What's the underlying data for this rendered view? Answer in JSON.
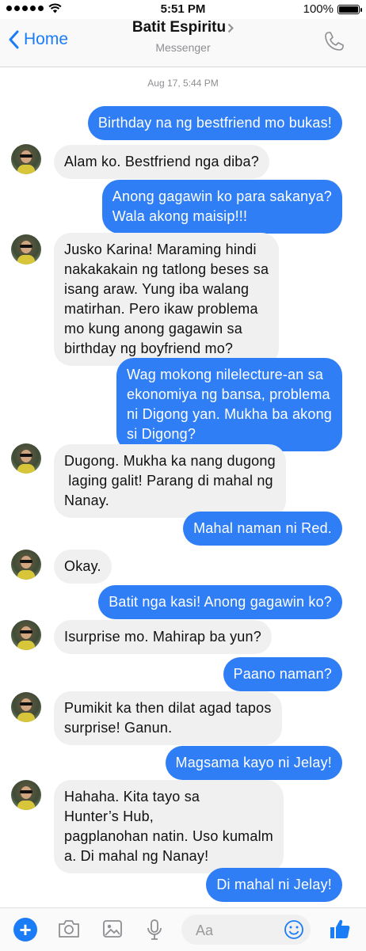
{
  "status_bar": {
    "time": "5:51 PM",
    "battery": "100%"
  },
  "header": {
    "back_label": "Home",
    "contact_name": "Batit Espiritu",
    "subtitle": "Messenger",
    "icons": {
      "back": "chevron-left-icon",
      "call": "phone-icon"
    }
  },
  "conversation": {
    "timestamp": "Aug 17, 5:44 PM",
    "messages": [
      {
        "side": "out",
        "lines": [
          "Birthday na ng bestfriend mo bukas!"
        ]
      },
      {
        "side": "in",
        "lines": [
          "Alam ko. Bestfriend nga diba?"
        ]
      },
      {
        "side": "out",
        "lines": [
          "Anong gagawin ko para sakanya?",
          "Wala akong maisip!!!"
        ]
      },
      {
        "side": "in",
        "lines": [
          "Jusko Karina! Maraming hindi",
          "nakakakain ng tatlong beses sa",
          "isang araw. Yung iba walang",
          "matirhan. Pero ikaw problema",
          "mo kung anong gagawin sa",
          "birthday ng boyfriend mo?"
        ]
      },
      {
        "side": "out",
        "lines": [
          "Wag mokong nilelecture-an sa",
          "ekonomiya ng bansa, problema",
          "ni Digong yan. Mukha ba akong",
          "si Digong?"
        ]
      },
      {
        "side": "in",
        "lines": [
          "Dugong. Mukha ka nang dugong",
          " laging galit! Parang di mahal ng",
          "Nanay."
        ]
      },
      {
        "side": "out",
        "lines": [
          "Mahal naman ni Red."
        ]
      },
      {
        "side": "in",
        "lines": [
          "Okay."
        ]
      },
      {
        "side": "out",
        "lines": [
          "Batit nga kasi! Anong gagawin ko?"
        ]
      },
      {
        "side": "in",
        "lines": [
          "Isurprise mo. Mahirap ba yun?"
        ]
      },
      {
        "side": "out",
        "lines": [
          "Paano naman?"
        ]
      },
      {
        "side": "in",
        "lines": [
          "Pumikit ka then dilat agad tapos",
          "surprise! Ganun."
        ]
      },
      {
        "side": "out",
        "lines": [
          "Magsama kayo ni Jelay!"
        ]
      },
      {
        "side": "in",
        "lines": [
          "Hahaha. Kita tayo sa",
          "Hunter’s Hub,",
          "pagplanohan natin. Uso kumalm",
          "a. Di mahal ng Nanay!"
        ]
      },
      {
        "side": "out",
        "lines": [
          "Di mahal ni Jelay!"
        ]
      }
    ]
  },
  "composer": {
    "placeholder": "Aa",
    "icons": [
      "plus-icon",
      "camera-icon",
      "photo-icon",
      "microphone-icon",
      "emoji-icon",
      "thumbs-up-icon"
    ]
  },
  "colors": {
    "accent": "#1a7cf6",
    "outgoing_bubble": "#2f7ef5",
    "incoming_bubble": "#f1f0f0"
  }
}
